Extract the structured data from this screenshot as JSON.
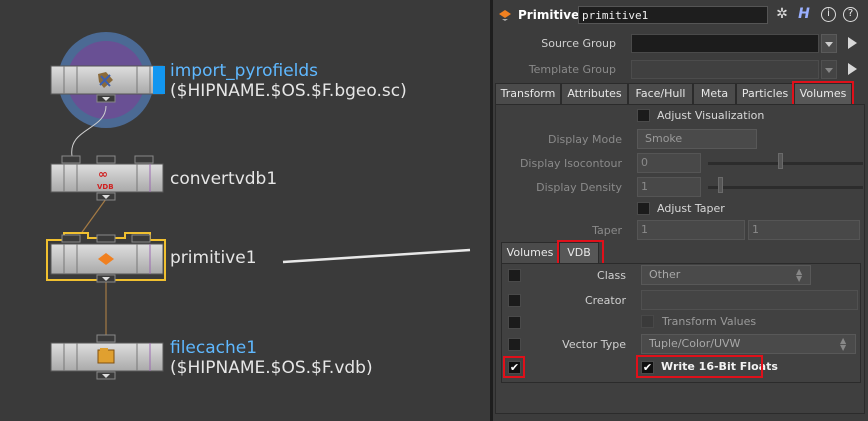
{
  "network": {
    "nodes": [
      {
        "name": "import_pyrofields",
        "subtitle": "($HIPNAME.$OS.$F.bgeo.sc)"
      },
      {
        "name": "convertvdb1",
        "subtitle": ""
      },
      {
        "name": "primitive1",
        "subtitle": ""
      },
      {
        "name": "filecache1",
        "subtitle": "($HIPNAME.$OS.$F.vdb)"
      }
    ],
    "convert_badge": "VDB"
  },
  "panel": {
    "node_type": "Primitive",
    "node_name": "primitive1",
    "header_icons": [
      "gear-icon",
      "help-h-icon",
      "info-icon",
      "question-icon"
    ],
    "source_group_label": "Source Group",
    "source_group_value": "",
    "template_group_label": "Template Group",
    "template_group_value": "",
    "main_tabs": [
      "Transform",
      "Attributes",
      "Face/Hull",
      "Meta",
      "Particles",
      "Volumes"
    ],
    "main_active_tab": "Volumes",
    "adjust_visualization": {
      "label": "Adjust Visualization",
      "checked": false
    },
    "display_mode": {
      "label": "Display Mode",
      "value": "Smoke"
    },
    "display_isocontour": {
      "label": "Display Isocontour",
      "value": "0"
    },
    "display_density": {
      "label": "Display Density",
      "value": "1"
    },
    "adjust_taper": {
      "label": "Adjust Taper",
      "checked": false
    },
    "taper": {
      "label": "Taper",
      "x": "1",
      "y": "1"
    },
    "sub_tabs": [
      "Volumes",
      "VDB"
    ],
    "sub_active_tab": "VDB",
    "vdb_class": {
      "label": "Class",
      "value": "Other"
    },
    "vdb_creator": {
      "label": "Creator",
      "value": ""
    },
    "transform_values": {
      "label": "Transform Values",
      "checked": false
    },
    "vector_type": {
      "label": "Vector Type",
      "value": "Tuple/Color/UVW"
    },
    "write_16bit": {
      "label": "Write 16-Bit Floats",
      "checked": true
    }
  },
  "colors": {
    "highlight_red": "#e0101a",
    "selected_node": "#f0c030",
    "name_blue": "#5fb8ff"
  }
}
